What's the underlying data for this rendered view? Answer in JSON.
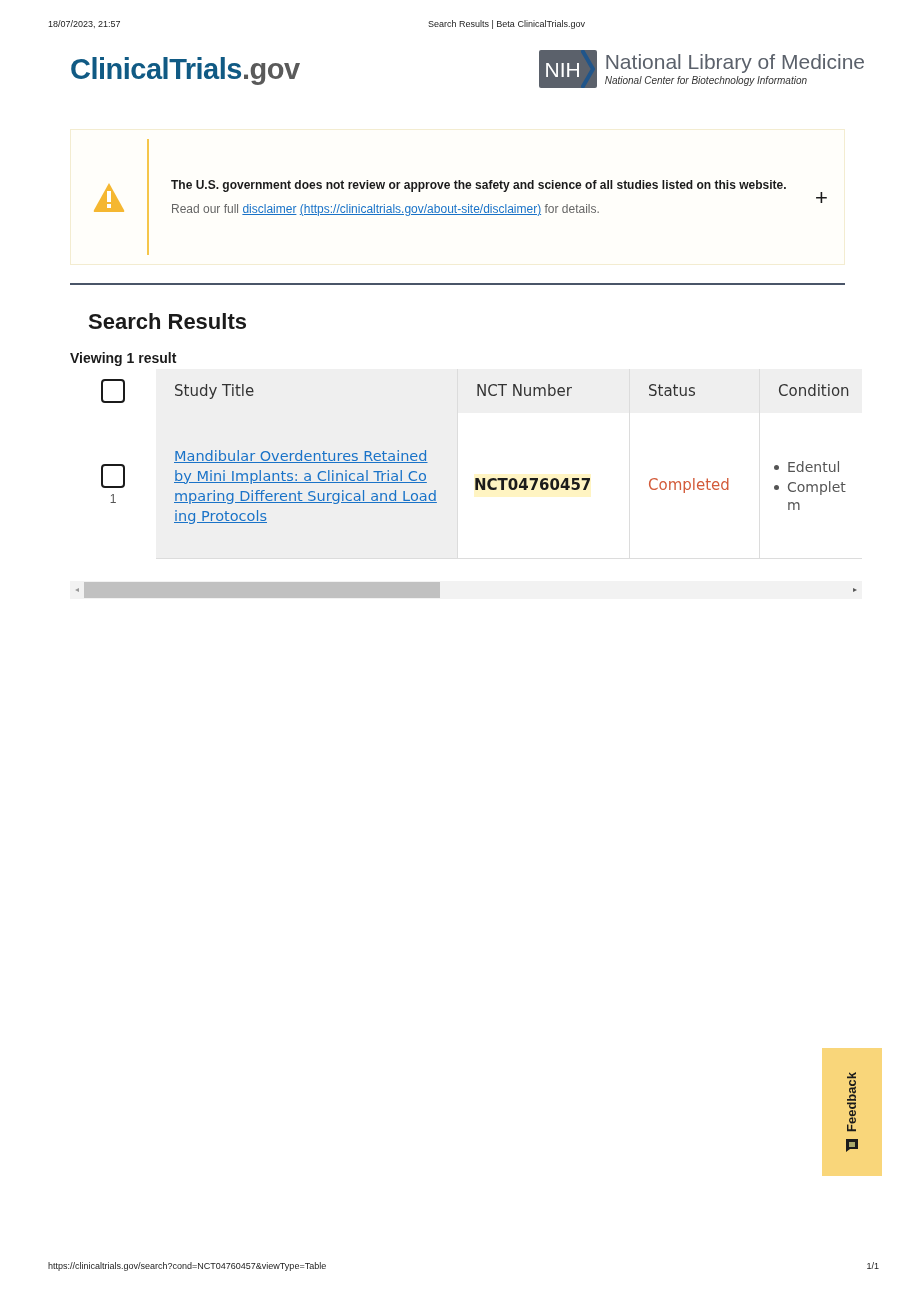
{
  "print_header": {
    "date": "18/07/2023, 21:57",
    "page_title": "Search Results | Beta ClinicalTrials.gov"
  },
  "logo": {
    "prefix": "ClinicalTrials",
    "suffix": ".gov"
  },
  "nlm": {
    "badge": "NIH",
    "title": "National Library of Medicine",
    "subtitle": "National Center for Biotechnology Information"
  },
  "disclaimer": {
    "heading": "The U.S. government does not review or approve the safety and science of all studies listed on this website.",
    "before": "Read our full",
    "link": "disclaimer",
    "url": "(https://clinicaltrials.gov/about-site/disclaimer)",
    "after": "for details.",
    "expand": "+",
    "expanded": false
  },
  "heading": "Search Results",
  "count": "Viewing 1 result",
  "table": {
    "select_all": {
      "checked": false
    },
    "columns": [
      "Study Title",
      "NCT Number",
      "Status",
      "Condition"
    ],
    "rows": [
      {
        "index": "1",
        "checked": false,
        "title": "Mandibular Overdentures Retained by Mini Implants: a Clinical Trial Comparing Different Surgical and Loading Protocols",
        "nct": "NCT04760457",
        "status": "Completed",
        "conditions": [
          [
            "Edentul"
          ],
          [
            "Complet",
            "m"
          ]
        ]
      }
    ]
  },
  "scrollbar": {
    "left": "◂",
    "right": "▸"
  },
  "feedback": "Feedback",
  "print_footer": {
    "url": "https://clinicaltrials.gov/search?cond=NCT04760457&viewType=Table",
    "page": "1/1"
  }
}
